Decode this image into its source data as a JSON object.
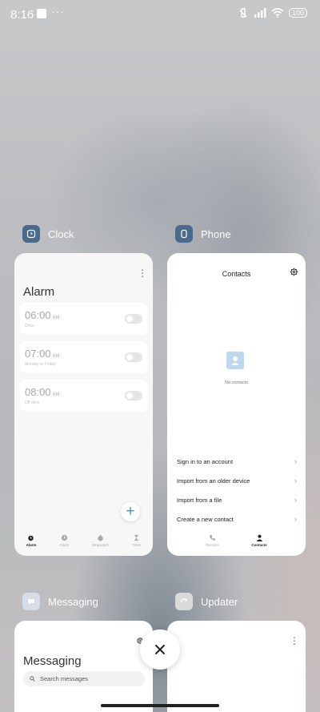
{
  "status_bar": {
    "time": "8:16",
    "more": "···",
    "battery": "100"
  },
  "apps": [
    {
      "name": "Clock",
      "icon": "clock-icon",
      "card": {
        "title": "Alarm",
        "alarms": [
          {
            "time": "06:00",
            "ampm": "AM",
            "repeat": "Once",
            "enabled": false
          },
          {
            "time": "07:00",
            "ampm": "AM",
            "repeat": "Monday to Friday",
            "enabled": false
          },
          {
            "time": "08:00",
            "ampm": "AM",
            "repeat": "Off days",
            "enabled": false
          }
        ],
        "tabs": [
          "Alarm",
          "Clock",
          "Stopwatch",
          "Timer"
        ],
        "active_tab": "Alarm"
      }
    },
    {
      "name": "Phone",
      "icon": "phone-icon",
      "card": {
        "title": "Contacts",
        "empty_text": "No contacts",
        "actions": [
          "Sign in to an account",
          "Import from an older device",
          "Import from a file",
          "Create a new contact"
        ],
        "tabs": [
          "Recents",
          "Contacts"
        ],
        "active_tab": "Contacts"
      }
    },
    {
      "name": "Messaging",
      "icon": "messaging-icon",
      "card": {
        "title": "Messaging",
        "search_placeholder": "Search messages"
      }
    },
    {
      "name": "Updater",
      "icon": "updater-icon",
      "card": {}
    }
  ],
  "colors": {
    "accent": "#3a8ee6",
    "card_bg": "#f7f7f7",
    "contact_placeholder": "#bcd7ee"
  }
}
